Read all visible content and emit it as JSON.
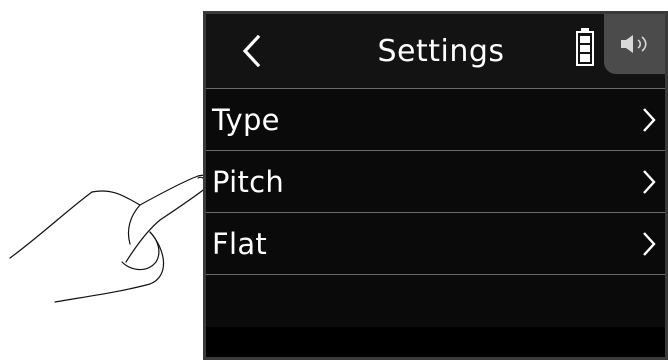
{
  "header": {
    "title": "Settings",
    "back_icon": "chevron-left-icon",
    "battery_icon": "battery-icon",
    "speaker_icon": "speaker-icon"
  },
  "menu": {
    "items": [
      {
        "label": "Type",
        "icon": "chevron-right-icon"
      },
      {
        "label": "Pitch",
        "icon": "chevron-right-icon"
      },
      {
        "label": "Flat",
        "icon": "chevron-right-icon"
      }
    ]
  },
  "colors": {
    "screen_bg": "#0a0a0a",
    "text": "#ffffff",
    "divider": "#6a6a6a",
    "speaker_tab": "#4b4b4b"
  }
}
